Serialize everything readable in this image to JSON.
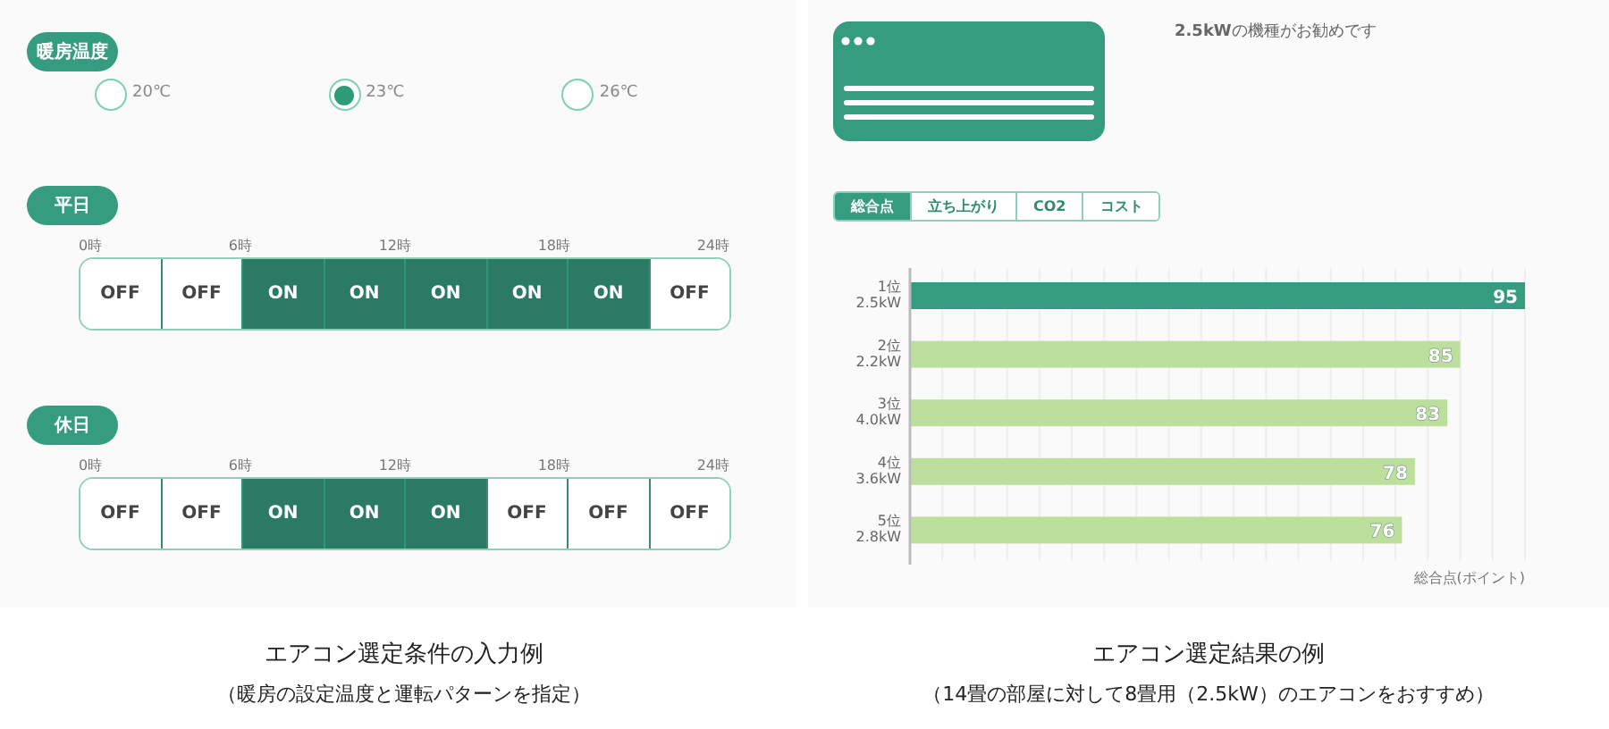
{
  "conditions": {
    "temperature": {
      "label": "暖房温度",
      "options": [
        {
          "label": "20℃",
          "selected": false
        },
        {
          "label": "23℃",
          "selected": true
        },
        {
          "label": "26℃",
          "selected": false
        }
      ]
    },
    "schedules": [
      {
        "label": "平日",
        "hours": [
          "0時",
          "6時",
          "12時",
          "18時",
          "24時"
        ],
        "slots": [
          {
            "text": "OFF",
            "on": false
          },
          {
            "text": "OFF",
            "on": false
          },
          {
            "text": "ON",
            "on": true
          },
          {
            "text": "ON",
            "on": true
          },
          {
            "text": "ON",
            "on": true
          },
          {
            "text": "ON",
            "on": true
          },
          {
            "text": "ON",
            "on": true
          },
          {
            "text": "OFF",
            "on": false
          }
        ]
      },
      {
        "label": "休日",
        "hours": [
          "0時",
          "6時",
          "12時",
          "18時",
          "24時"
        ],
        "slots": [
          {
            "text": "OFF",
            "on": false
          },
          {
            "text": "OFF",
            "on": false
          },
          {
            "text": "ON",
            "on": true
          },
          {
            "text": "ON",
            "on": true
          },
          {
            "text": "ON",
            "on": true
          },
          {
            "text": "OFF",
            "on": false
          },
          {
            "text": "OFF",
            "on": false
          },
          {
            "text": "OFF",
            "on": false
          }
        ]
      }
    ]
  },
  "result": {
    "message": "**2.5kW**の機種がお勧めです",
    "tabs": [
      {
        "label": "総合点",
        "selected": true
      },
      {
        "label": "立ち上がり",
        "selected": false
      },
      {
        "label": "CO2",
        "selected": false
      },
      {
        "label": "コスト",
        "selected": false
      }
    ],
    "chart_data": {
      "type": "bar",
      "orientation": "horizontal",
      "stacked": true,
      "data_labels": true,
      "xlabel": "総合点(ポイント)",
      "xlim": [
        0,
        95
      ],
      "categories": [
        "1位\n2.5kW",
        "2位\n2.2kW",
        "3位\n4.0kW",
        "4位\n3.6kW",
        "5位\n2.8kW"
      ],
      "series": [
        {
          "color": "#359c80",
          "values": [
            95,
            null,
            null,
            null,
            null
          ]
        },
        {
          "color": "#bddf9e",
          "values": [
            null,
            85,
            83,
            78,
            76
          ]
        }
      ]
    }
  },
  "captions": [
    {
      "title": "エアコン選定条件の入力例",
      "subtitle": "（暖房の設定温度と運転パターンを指定）"
    },
    {
      "title": "エアコン選定結果の例",
      "subtitle": "（14畳の部屋に対して8畳用（2.5kW）のエアコンをおすすめ）"
    }
  ]
}
